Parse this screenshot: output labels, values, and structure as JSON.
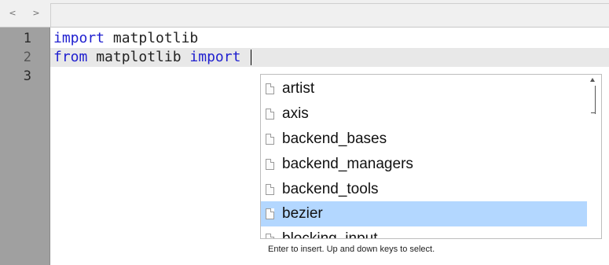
{
  "nav": {
    "back": "<",
    "forward": ">"
  },
  "editor": {
    "line_numbers": [
      "1",
      "2",
      "3"
    ],
    "lines": [
      {
        "kw1": "import",
        "rest1": " matplotlib"
      },
      {
        "kw1": "from",
        "rest1": " matplotlib ",
        "kw2": "import",
        "rest2": " "
      },
      {
        "text": ""
      }
    ]
  },
  "autocomplete": {
    "items": [
      "artist",
      "axis",
      "backend_bases",
      "backend_managers",
      "backend_tools",
      "bezier",
      "blocking_input"
    ],
    "selected": "bezier",
    "hint": "Enter to insert. Up and down keys to select."
  },
  "colors": {
    "keyword": "#1f1fcf",
    "gutter": "#a0a0a0",
    "selection": "#b3d7ff",
    "active_line": "#e8e8e8"
  }
}
